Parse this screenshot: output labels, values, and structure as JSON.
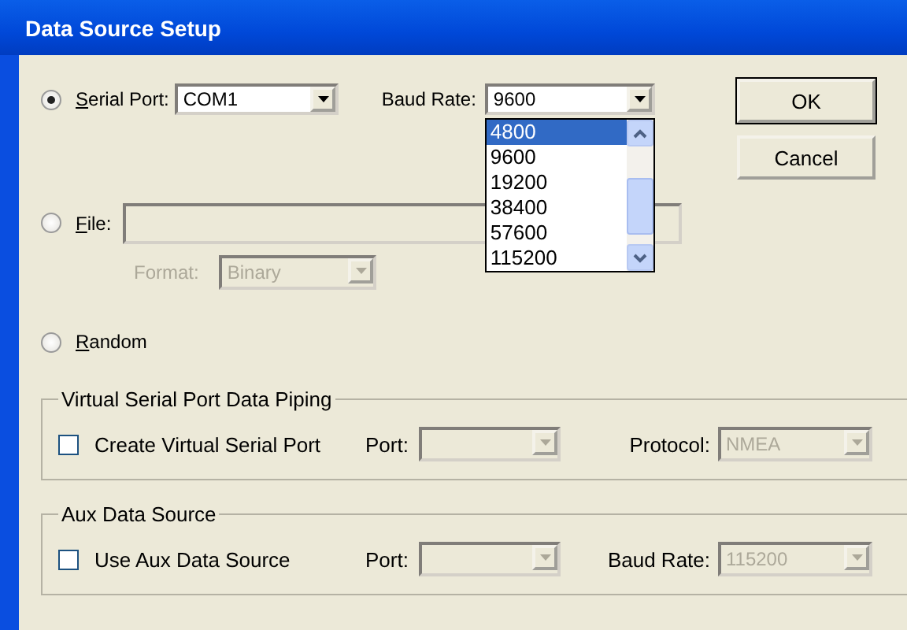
{
  "window": {
    "title": "Data Source Setup"
  },
  "sources": [
    {
      "kind": "serial",
      "label": "Serial Port:",
      "mnemonic": true,
      "selected": true,
      "port_value": "COM1",
      "baud_label": "Baud Rate:",
      "baud_value": "9600",
      "baud_expanded": true,
      "baud_options": [
        {
          "label": "4800",
          "selected": true
        },
        {
          "label": "9600",
          "selected": false
        },
        {
          "label": "19200",
          "selected": false
        },
        {
          "label": "38400",
          "selected": false
        },
        {
          "label": "57600",
          "selected": false
        },
        {
          "label": "115200",
          "selected": false
        }
      ]
    },
    {
      "kind": "file",
      "label": "File:",
      "mnemonic": true,
      "selected": false,
      "disabled": true,
      "format_label": "Format:",
      "format_value": "Binary"
    },
    {
      "kind": "random",
      "label": "Random",
      "mnemonic": true,
      "selected": false
    }
  ],
  "buttons": [
    {
      "label": "OK",
      "default": true
    },
    {
      "label": "Cancel",
      "default": false
    }
  ],
  "groups": [
    {
      "title": "Virtual Serial Port Data Piping",
      "checkbox": {
        "label": "Create Virtual Serial Port",
        "checked": false
      },
      "port_label": "Port:",
      "field_label": "Protocol:",
      "field_value": "NMEA",
      "disabled": true
    },
    {
      "title": "Aux Data Source",
      "checkbox": {
        "label": "Use Aux Data Source",
        "checked": false
      },
      "port_label": "Port:",
      "field_label": "Baud Rate:",
      "field_value": "115200",
      "disabled": true
    }
  ]
}
